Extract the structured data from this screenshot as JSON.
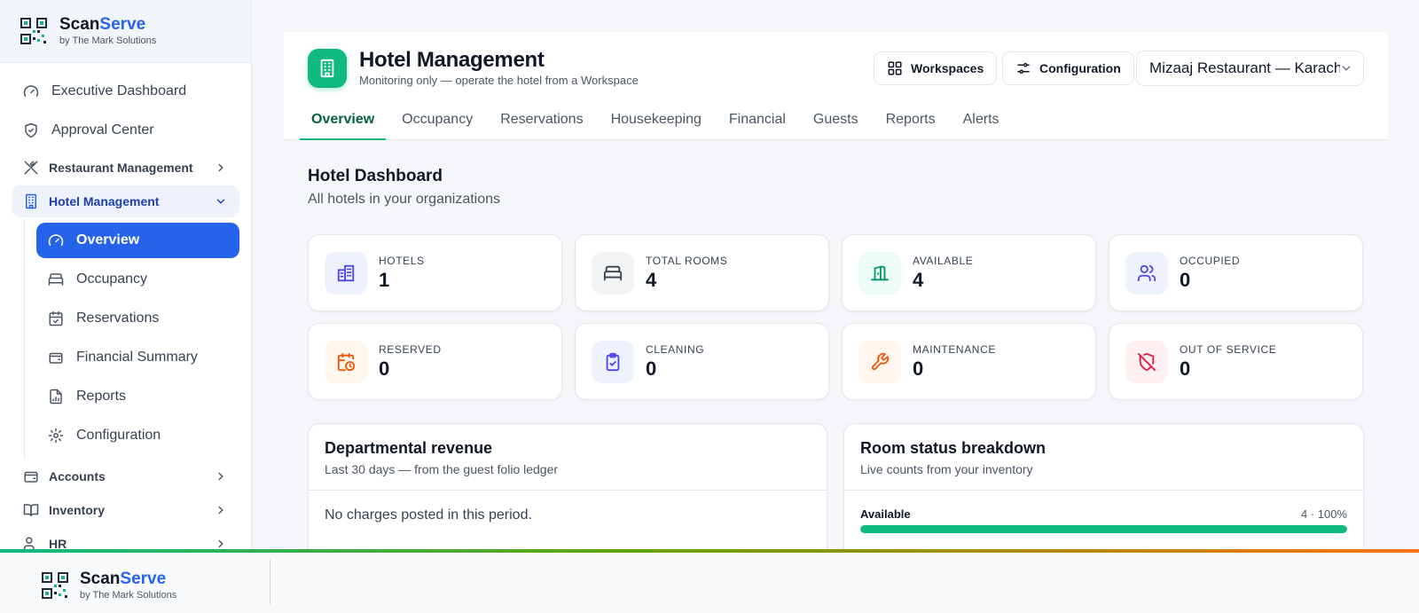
{
  "brand": {
    "name_part1": "Scan",
    "name_part2": "Serve",
    "tagline": "by The Mark Solutions"
  },
  "sidebar": {
    "items": [
      {
        "label": "Executive Dashboard"
      },
      {
        "label": "Approval Center"
      }
    ],
    "groups": {
      "restaurant": "Restaurant Management",
      "hotel": "Hotel Management",
      "accounts": "Accounts",
      "inventory": "Inventory",
      "hr": "HR"
    },
    "hotel_sub": [
      {
        "label": "Overview"
      },
      {
        "label": "Occupancy"
      },
      {
        "label": "Reservations"
      },
      {
        "label": "Financial Summary"
      },
      {
        "label": "Reports"
      },
      {
        "label": "Configuration"
      }
    ]
  },
  "header": {
    "title": "Hotel Management",
    "subtitle": "Monitoring only — operate the hotel from a Workspace",
    "workspaces_label": "Workspaces",
    "configuration_label": "Configuration",
    "selected_restaurant": "Mizaaj Restaurant — Karachi"
  },
  "tabs": [
    "Overview",
    "Occupancy",
    "Reservations",
    "Housekeeping",
    "Financial",
    "Guests",
    "Reports",
    "Alerts"
  ],
  "dashboard": {
    "title": "Hotel Dashboard",
    "subtitle": "All hotels in your organizations"
  },
  "stats": [
    {
      "label": "Hotels",
      "value": "1",
      "icon": "hotel-icon",
      "color": "#4f46e5",
      "bg": "#eef2ff"
    },
    {
      "label": "Total Rooms",
      "value": "4",
      "icon": "bed-icon",
      "color": "#374151",
      "bg": "#f3f4f6"
    },
    {
      "label": "Available",
      "value": "4",
      "icon": "door-open-icon",
      "color": "#059669",
      "bg": "#ecfdf5"
    },
    {
      "label": "Occupied",
      "value": "0",
      "icon": "users-icon",
      "color": "#4f46e5",
      "bg": "#eef2ff"
    },
    {
      "label": "Reserved",
      "value": "0",
      "icon": "calendar-clock-icon",
      "color": "#ea580c",
      "bg": "#fff7ed"
    },
    {
      "label": "Cleaning",
      "value": "0",
      "icon": "clipboard-check-icon",
      "color": "#4f46e5",
      "bg": "#eef2ff"
    },
    {
      "label": "Maintenance",
      "value": "0",
      "icon": "wrench-icon",
      "color": "#ea580c",
      "bg": "#fff7ed"
    },
    {
      "label": "Out of Service",
      "value": "0",
      "icon": "shield-off-icon",
      "color": "#e11d48",
      "bg": "#fff1f2"
    }
  ],
  "revenue_panel": {
    "title": "Departmental revenue",
    "subtitle": "Last 30 days — from the guest folio ledger",
    "empty_text": "No charges posted in this period."
  },
  "room_status_panel": {
    "title": "Room status breakdown",
    "subtitle": "Live counts from your inventory",
    "rows": [
      {
        "name": "Available",
        "count": "4 · 100%",
        "fraction": 1.0
      }
    ]
  },
  "colors": {
    "accent": "#2563eb",
    "brand_green": "#10b981",
    "gradient_end": "#f97316"
  }
}
